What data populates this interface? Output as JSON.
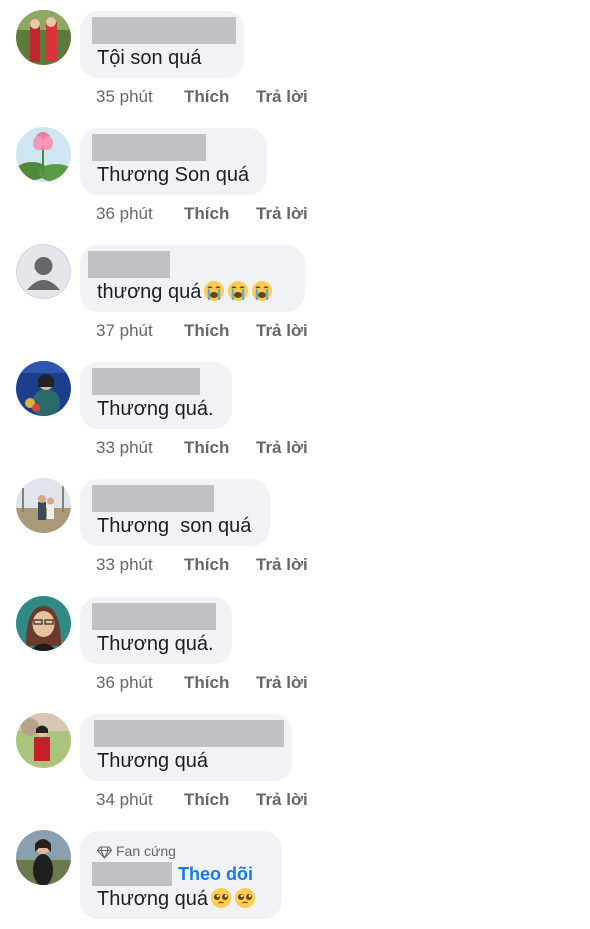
{
  "comments": [
    {
      "text": "Tội son quá",
      "time": "35 phút",
      "like": "Thích",
      "reply": "Trả lời",
      "emoji_count": 0
    },
    {
      "text": "Thương Son quá",
      "time": "36 phút",
      "like": "Thích",
      "reply": "Trả lời",
      "emoji_count": 0
    },
    {
      "text": "thương quá",
      "time": "37 phút",
      "like": "Thích",
      "reply": "Trả lời",
      "emoji": "loudly-crying-face",
      "emoji_count": 3
    },
    {
      "text": "Thương quá.",
      "time": "33 phút",
      "like": "Thích",
      "reply": "Trả lời",
      "emoji_count": 0
    },
    {
      "text": "Thương  son quá",
      "time": "33 phút",
      "like": "Thích",
      "reply": "Trả lời",
      "emoji_count": 0
    },
    {
      "text": "Thương quá.",
      "time": "36 phút",
      "like": "Thích",
      "reply": "Trả lời",
      "emoji_count": 0
    },
    {
      "text": "Thương quá",
      "time": "34 phút",
      "like": "Thích",
      "reply": "Trả lời",
      "emoji_count": 0
    },
    {
      "badge": "Fan cứng",
      "badge_icon": "diamond-icon",
      "follow": "Theo dõi",
      "text": "Thương quá",
      "emoji": "pleading-face",
      "emoji_count": 2
    }
  ],
  "colors": {
    "bubble": "#f0f2f5",
    "redaction": "#bfc1c4",
    "meta_text": "#65676b",
    "link": "#1877f2"
  }
}
